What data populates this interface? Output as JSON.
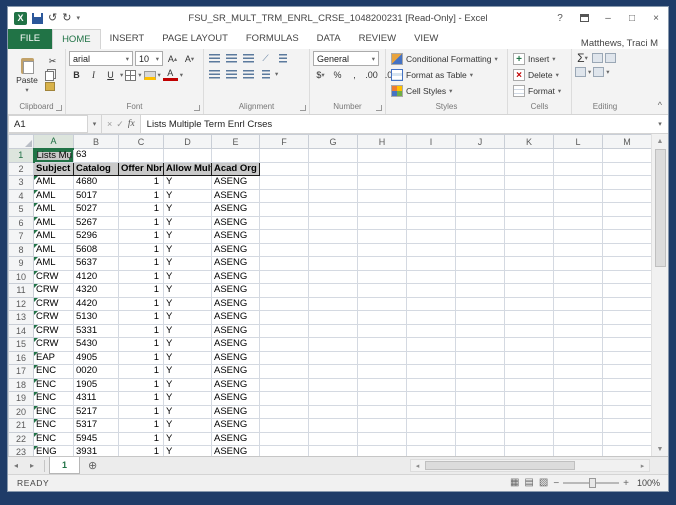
{
  "titlebar": {
    "title": "FSU_SR_MULT_TRM_ENRL_CRSE_1048200231  [Read-Only] - Excel",
    "help": "?",
    "minimize": "–",
    "maximize": "□",
    "close": "×"
  },
  "ribbon": {
    "file_tab": "FILE",
    "tabs": [
      "HOME",
      "INSERT",
      "PAGE LAYOUT",
      "FORMULAS",
      "DATA",
      "REVIEW",
      "VIEW"
    ],
    "active_tab": "HOME",
    "user": "Matthews, Traci M",
    "clipboard": {
      "label": "Clipboard",
      "paste": "Paste"
    },
    "font": {
      "label": "Font",
      "name": "arial",
      "size": "10",
      "bold": "B",
      "italic": "I",
      "underline": "U",
      "grow": "A",
      "shrink": "A",
      "color": "A"
    },
    "alignment": {
      "label": "Alignment"
    },
    "number": {
      "label": "Number",
      "format": "General",
      "currency": "$",
      "percent": "%",
      "comma": ",",
      "dec_inc": ".00",
      "dec_dec": ".0"
    },
    "styles": {
      "label": "Styles",
      "conditional_formatting": "Conditional Formatting",
      "format_as_table": "Format as Table",
      "cell_styles": "Cell Styles"
    },
    "cells": {
      "label": "Cells",
      "insert": "Insert",
      "delete": "Delete",
      "format": "Format"
    },
    "editing": {
      "label": "Editing",
      "autosum": "Σ"
    }
  },
  "formula_bar": {
    "name_box": "A1",
    "cancel": "×",
    "enter": "✓",
    "fx": "fx",
    "value": "Lists Multiple Term Enrl Crses"
  },
  "grid": {
    "columns": [
      "A",
      "B",
      "C",
      "D",
      "E",
      "F",
      "G",
      "H",
      "I",
      "J",
      "K",
      "L",
      "M"
    ],
    "selected_column": "A",
    "selected_cell": "A1",
    "title_row": {
      "number": "1",
      "A": "Lists Mu",
      "B": "63"
    },
    "header_row": {
      "number": "2",
      "labels": [
        "Subject",
        "Catalog",
        "Offer Nbr",
        "Allow Mult",
        "Acad Org"
      ]
    },
    "data_rows": [
      {
        "n": "3",
        "subject": "AML",
        "catalog": "4680",
        "offer": "1",
        "allow": "Y",
        "org": "ASENG"
      },
      {
        "n": "4",
        "subject": "AML",
        "catalog": "5017",
        "offer": "1",
        "allow": "Y",
        "org": "ASENG"
      },
      {
        "n": "5",
        "subject": "AML",
        "catalog": "5027",
        "offer": "1",
        "allow": "Y",
        "org": "ASENG"
      },
      {
        "n": "6",
        "subject": "AML",
        "catalog": "5267",
        "offer": "1",
        "allow": "Y",
        "org": "ASENG"
      },
      {
        "n": "7",
        "subject": "AML",
        "catalog": "5296",
        "offer": "1",
        "allow": "Y",
        "org": "ASENG"
      },
      {
        "n": "8",
        "subject": "AML",
        "catalog": "5608",
        "offer": "1",
        "allow": "Y",
        "org": "ASENG"
      },
      {
        "n": "9",
        "subject": "AML",
        "catalog": "5637",
        "offer": "1",
        "allow": "Y",
        "org": "ASENG"
      },
      {
        "n": "10",
        "subject": "CRW",
        "catalog": "4120",
        "offer": "1",
        "allow": "Y",
        "org": "ASENG"
      },
      {
        "n": "11",
        "subject": "CRW",
        "catalog": "4320",
        "offer": "1",
        "allow": "Y",
        "org": "ASENG"
      },
      {
        "n": "12",
        "subject": "CRW",
        "catalog": "4420",
        "offer": "1",
        "allow": "Y",
        "org": "ASENG"
      },
      {
        "n": "13",
        "subject": "CRW",
        "catalog": "5130",
        "offer": "1",
        "allow": "Y",
        "org": "ASENG"
      },
      {
        "n": "14",
        "subject": "CRW",
        "catalog": "5331",
        "offer": "1",
        "allow": "Y",
        "org": "ASENG"
      },
      {
        "n": "15",
        "subject": "CRW",
        "catalog": "5430",
        "offer": "1",
        "allow": "Y",
        "org": "ASENG"
      },
      {
        "n": "16",
        "subject": "EAP",
        "catalog": "4905",
        "offer": "1",
        "allow": "Y",
        "org": "ASENG"
      },
      {
        "n": "17",
        "subject": "ENC",
        "catalog": "0020",
        "offer": "1",
        "allow": "Y",
        "org": "ASENG"
      },
      {
        "n": "18",
        "subject": "ENC",
        "catalog": "1905",
        "offer": "1",
        "allow": "Y",
        "org": "ASENG"
      },
      {
        "n": "19",
        "subject": "ENC",
        "catalog": "4311",
        "offer": "1",
        "allow": "Y",
        "org": "ASENG"
      },
      {
        "n": "20",
        "subject": "ENC",
        "catalog": "5217",
        "offer": "1",
        "allow": "Y",
        "org": "ASENG"
      },
      {
        "n": "21",
        "subject": "ENC",
        "catalog": "5317",
        "offer": "1",
        "allow": "Y",
        "org": "ASENG"
      },
      {
        "n": "22",
        "subject": "ENC",
        "catalog": "5945",
        "offer": "1",
        "allow": "Y",
        "org": "ASENG"
      },
      {
        "n": "23",
        "subject": "ENG",
        "catalog": "3931",
        "offer": "1",
        "allow": "Y",
        "org": "ASENG"
      }
    ]
  },
  "sheet_bar": {
    "active_tab": "1"
  },
  "status_bar": {
    "ready": "READY",
    "zoom": "100%"
  }
}
